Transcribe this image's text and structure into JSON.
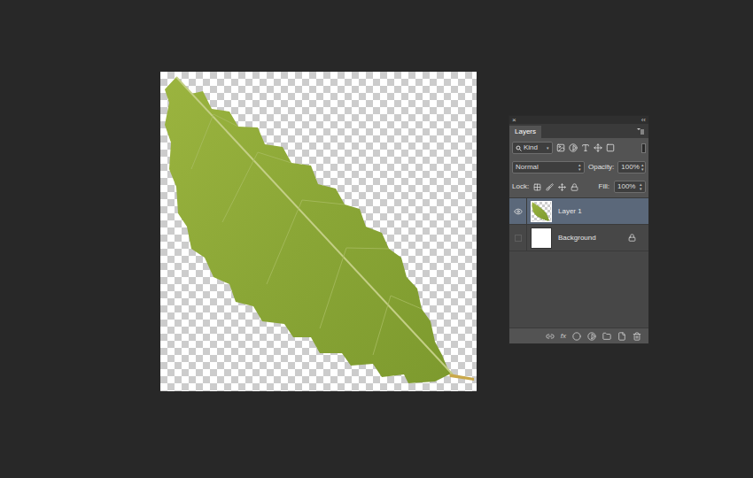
{
  "panel": {
    "close": "×",
    "collapse": "‹‹",
    "tabs": [
      {
        "label": "Layers",
        "selected": true
      }
    ],
    "filter": {
      "kind": "Kind"
    },
    "blend_mode": "Normal",
    "opacity_label": "Opacity:",
    "opacity": "100%",
    "lock_label": "Lock:",
    "fill_label": "Fill:",
    "fill": "100%"
  },
  "layers": [
    {
      "name": "Layer 1",
      "visible": true,
      "selected": true,
      "locked": false,
      "kind": "leaf"
    },
    {
      "name": "Background",
      "visible": false,
      "selected": false,
      "locked": true,
      "kind": "white"
    }
  ],
  "bottom_bar": {
    "fx": "fx"
  }
}
